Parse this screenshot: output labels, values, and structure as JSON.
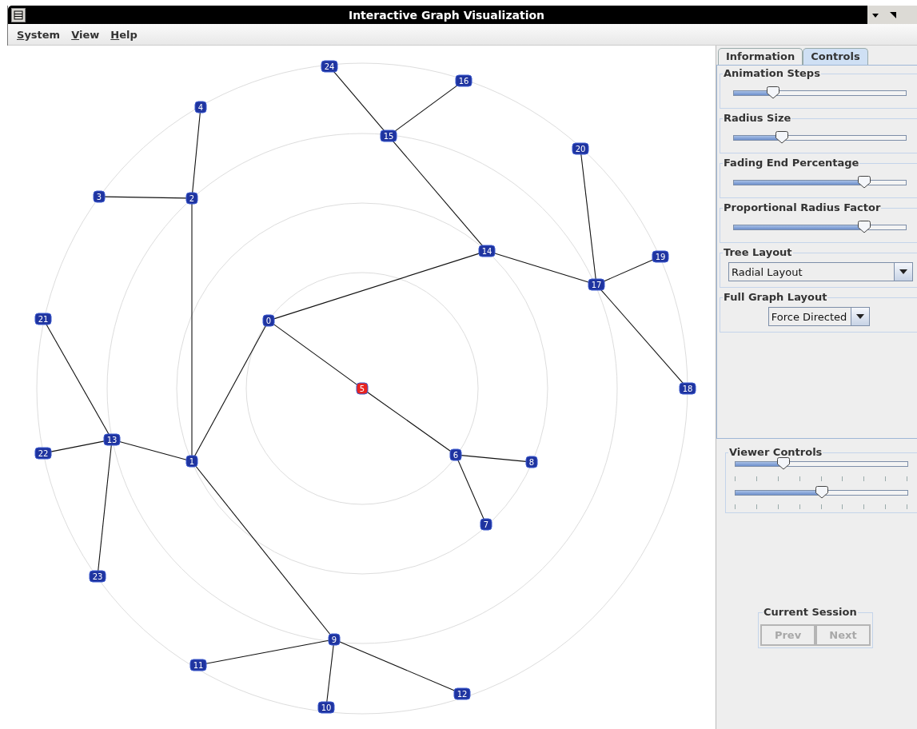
{
  "window": {
    "title": "Interactive Graph Visualization"
  },
  "menu": [
    {
      "label": "System"
    },
    {
      "label": "View"
    },
    {
      "label": "Help"
    }
  ],
  "graph": {
    "root": {
      "label": "5",
      "selected": true,
      "children": [
        {
          "label": "0",
          "selected": false,
          "children": [
            {
              "label": "1",
              "selected": false,
              "children": [
                {
                  "label": "2",
                  "selected": false,
                  "children": [
                    {
                      "label": "3",
                      "selected": false
                    },
                    {
                      "label": "4",
                      "selected": false
                    }
                  ]
                },
                {
                  "label": "13",
                  "selected": false,
                  "children": [
                    {
                      "label": "21",
                      "selected": false
                    },
                    {
                      "label": "22",
                      "selected": false
                    },
                    {
                      "label": "23",
                      "selected": false
                    }
                  ]
                },
                {
                  "label": "9",
                  "selected": false,
                  "children": [
                    {
                      "label": "11",
                      "selected": false
                    },
                    {
                      "label": "10",
                      "selected": false
                    },
                    {
                      "label": "12",
                      "selected": false
                    }
                  ]
                }
              ]
            },
            {
              "label": "14",
              "selected": false,
              "children": [
                {
                  "label": "15",
                  "selected": false,
                  "children": [
                    {
                      "label": "24",
                      "selected": false
                    },
                    {
                      "label": "16",
                      "selected": false
                    }
                  ]
                },
                {
                  "label": "17",
                  "selected": false,
                  "children": [
                    {
                      "label": "20",
                      "selected": false
                    },
                    {
                      "label": "19",
                      "selected": false
                    },
                    {
                      "label": "18",
                      "selected": false
                    }
                  ]
                }
              ]
            }
          ]
        },
        {
          "label": "6",
          "selected": false,
          "children": [
            {
              "label": "8",
              "selected": false
            },
            {
              "label": "7",
              "selected": false
            }
          ]
        }
      ]
    }
  },
  "tabs": [
    {
      "label": "Information",
      "selected": false
    },
    {
      "label": "Controls",
      "selected": true
    }
  ],
  "controls": [
    {
      "kind": "slider",
      "title": "Animation Steps",
      "level": 0.23
    },
    {
      "kind": "slider",
      "title": "Radius Size",
      "level": 0.28
    },
    {
      "kind": "slider",
      "title": "Fading End Percentage",
      "level": 0.76
    },
    {
      "kind": "slider",
      "title": "Proportional Radius Factor",
      "level": 0.76
    },
    {
      "kind": "dropdown",
      "title": "Tree Layout",
      "value": "Radial Layout"
    },
    {
      "kind": "small-dropdown",
      "title": "Full Graph Layout",
      "value": "Force Directed"
    }
  ],
  "viewer_controls": {
    "title": "Viewer Controls",
    "sliders": [
      {
        "level": 0.28
      },
      {
        "level": 0.5
      }
    ]
  },
  "current_session": {
    "title": "Current Session",
    "buttons": [
      {
        "label": "Prev",
        "disabled": true
      },
      {
        "label": "Next",
        "disabled": true
      }
    ]
  }
}
